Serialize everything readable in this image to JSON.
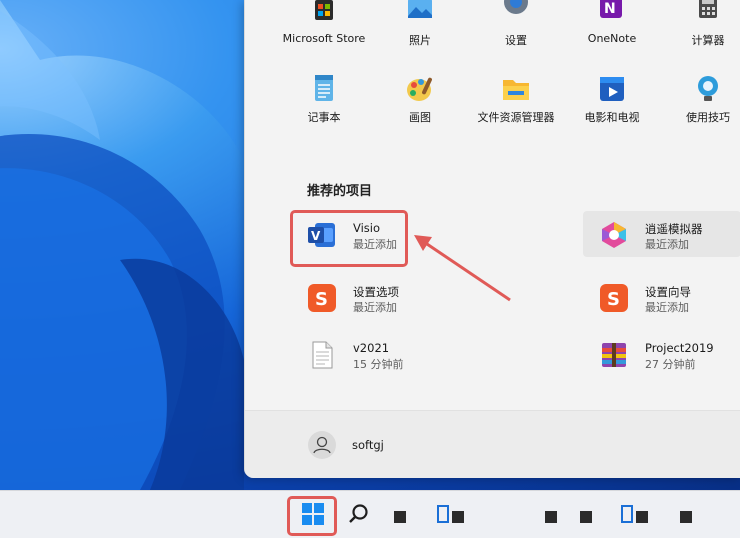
{
  "pinned_apps": [
    {
      "label": "Microsoft Store",
      "icon": "store-icon"
    },
    {
      "label": "照片",
      "icon": "photos-icon"
    },
    {
      "label": "设置",
      "icon": "settings-icon"
    },
    {
      "label": "OneNote",
      "icon": "onenote-icon"
    },
    {
      "label": "计算器",
      "icon": "calculator-icon"
    },
    {
      "label": "记事本",
      "icon": "notepad-icon"
    },
    {
      "label": "画图",
      "icon": "paint-icon"
    },
    {
      "label": "文件资源管理器",
      "icon": "folder-icon"
    },
    {
      "label": "电影和电视",
      "icon": "movies-icon"
    },
    {
      "label": "使用技巧",
      "icon": "tips-icon"
    }
  ],
  "recommended": {
    "title": "推荐的项目",
    "items": [
      {
        "name": "Visio",
        "sub": "最近添加",
        "icon": "visio-icon"
      },
      {
        "name": "逍遥模拟器",
        "sub": "最近添加",
        "icon": "emulator-icon"
      },
      {
        "name": "设置选项",
        "sub": "最近添加",
        "icon": "sogou-icon"
      },
      {
        "name": "设置向导",
        "sub": "最近添加",
        "icon": "sogou-icon"
      },
      {
        "name": "v2021",
        "sub": "15 分钟前",
        "icon": "document-icon"
      },
      {
        "name": "Project2019",
        "sub": "27 分钟前",
        "icon": "archive-icon"
      }
    ]
  },
  "user": {
    "name": "softgj"
  },
  "colors": {
    "annotation_red": "#e05a57",
    "start_bg": "#f3f3f3"
  }
}
